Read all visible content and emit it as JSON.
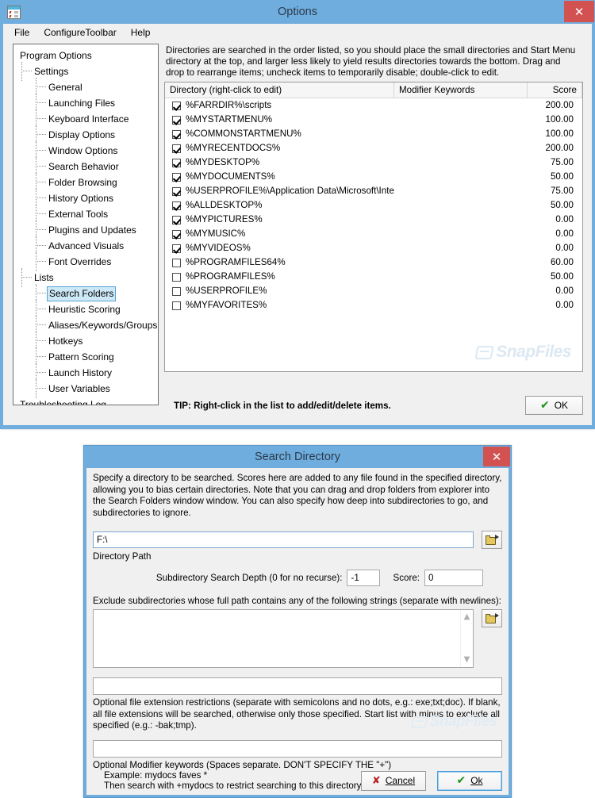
{
  "options_window": {
    "title": "Options",
    "icon": "options-checklist-icon",
    "close_label": "✕",
    "menu": [
      "File",
      "ConfigureToolbar",
      "Help"
    ],
    "tree": [
      {
        "label": "Program Options",
        "level": 0,
        "selected": false
      },
      {
        "label": "Settings",
        "level": 1,
        "selected": false
      },
      {
        "label": "General",
        "level": 2,
        "selected": false
      },
      {
        "label": "Launching Files",
        "level": 2,
        "selected": false
      },
      {
        "label": "Keyboard Interface",
        "level": 2,
        "selected": false
      },
      {
        "label": "Display Options",
        "level": 2,
        "selected": false
      },
      {
        "label": "Window Options",
        "level": 2,
        "selected": false
      },
      {
        "label": "Search Behavior",
        "level": 2,
        "selected": false
      },
      {
        "label": "Folder Browsing",
        "level": 2,
        "selected": false
      },
      {
        "label": "History Options",
        "level": 2,
        "selected": false
      },
      {
        "label": "External Tools",
        "level": 2,
        "selected": false
      },
      {
        "label": "Plugins and Updates",
        "level": 2,
        "selected": false
      },
      {
        "label": "Advanced Visuals",
        "level": 2,
        "selected": false
      },
      {
        "label": "Font Overrides",
        "level": 2,
        "selected": false
      },
      {
        "label": "Lists",
        "level": 1,
        "selected": false
      },
      {
        "label": "Search Folders",
        "level": 2,
        "selected": true
      },
      {
        "label": "Heuristic Scoring",
        "level": 2,
        "selected": false
      },
      {
        "label": "Aliases/Keywords/Groups",
        "level": 2,
        "selected": false
      },
      {
        "label": "Hotkeys",
        "level": 2,
        "selected": false
      },
      {
        "label": "Pattern Scoring",
        "level": 2,
        "selected": false
      },
      {
        "label": "Launch History",
        "level": 2,
        "selected": false
      },
      {
        "label": "User Variables",
        "level": 2,
        "selected": false
      },
      {
        "label": "Troubleshooting Log",
        "level": 0,
        "selected": false
      }
    ],
    "description": "Directories are searched in the order listed, so you should place the small directories and Start Menu directory at the top, and larger less likely to yield results directories towards the bottom.  Drag and drop to rearrange items; uncheck items to temporarily disable; double-click to edit.",
    "list": {
      "columns": [
        "Directory (right-click to edit)",
        "Modifier Keywords",
        "Score"
      ],
      "rows": [
        {
          "checked": true,
          "directory": "%FARRDIR%\\scripts",
          "modifier": "",
          "score": "200.00"
        },
        {
          "checked": true,
          "directory": "%MYSTARTMENU%",
          "modifier": "",
          "score": "100.00"
        },
        {
          "checked": true,
          "directory": "%COMMONSTARTMENU%",
          "modifier": "",
          "score": "100.00"
        },
        {
          "checked": true,
          "directory": "%MYRECENTDOCS%",
          "modifier": "",
          "score": "200.00"
        },
        {
          "checked": true,
          "directory": "%MYDESKTOP%",
          "modifier": "",
          "score": "75.00"
        },
        {
          "checked": true,
          "directory": "%MYDOCUMENTS%",
          "modifier": "",
          "score": "50.00"
        },
        {
          "checked": true,
          "directory": "%USERPROFILE%\\Application Data\\Microsoft\\Inte...",
          "modifier": "",
          "score": "75.00"
        },
        {
          "checked": true,
          "directory": "%ALLDESKTOP%",
          "modifier": "",
          "score": "50.00"
        },
        {
          "checked": true,
          "directory": "%MYPICTURES%",
          "modifier": "",
          "score": "0.00"
        },
        {
          "checked": true,
          "directory": "%MYMUSIC%",
          "modifier": "",
          "score": "0.00"
        },
        {
          "checked": true,
          "directory": "%MYVIDEOS%",
          "modifier": "",
          "score": "0.00"
        },
        {
          "checked": false,
          "directory": "%PROGRAMFILES64%",
          "modifier": "",
          "score": "60.00"
        },
        {
          "checked": false,
          "directory": "%PROGRAMFILES%",
          "modifier": "",
          "score": "50.00"
        },
        {
          "checked": false,
          "directory": "%USERPROFILE%",
          "modifier": "",
          "score": "0.00"
        },
        {
          "checked": false,
          "directory": "%MYFAVORITES%",
          "modifier": "",
          "score": "0.00"
        }
      ]
    },
    "watermark": "SnapFiles",
    "tip": "TIP: Right-click in the list to add/edit/delete items.",
    "ok_label": "OK"
  },
  "search_window": {
    "title": "Search Directory",
    "close_label": "✕",
    "description": "Specify a directory to be searched. Scores here are added to any file found in the specified directory, allowing you to bias certain directories.  Note that you can drag and drop folders from explorer into the Search Folders window window.  You can also specify how deep into subdirectories to go, and subdirectories to ignore.",
    "directory_path": {
      "value": "F:\\",
      "placeholder": "",
      "label": "Directory Path",
      "browse_icon": "folder-open-icon"
    },
    "depth": {
      "label": "Subdirectory Search Depth (0 for no recurse):",
      "value": "-1"
    },
    "score": {
      "label": "Score:",
      "value": "0"
    },
    "exclude": {
      "label": "Exclude subdirectories whose full path contains any of the following strings (separate with newlines):",
      "value": "",
      "placeholder": "",
      "browse_icon": "folder-open-icon",
      "scroll_up": "︿",
      "scroll_down": "﹀"
    },
    "extensions": {
      "value": "",
      "placeholder": "",
      "help": "Optional file extension restrictions (separate with semicolons and no dots, e.g.: exe;txt;doc).  If blank, all file extensions will be searched, otherwise only those specified.  Start list with minus to exclude all specified (e.g.: -bak;tmp)."
    },
    "modifier_keywords": {
      "value": "",
      "placeholder": "",
      "help_line1": "Optional Modifier keywords (Spaces separate. DON'T SPECIFY THE \"+\")",
      "help_line2": "Example: mydocs faves *",
      "help_line3": "Then search with +mydocs to restrict searching to this directory."
    },
    "watermark": "SnapFiles",
    "cancel_label": "Cancel",
    "ok_label": "Ok"
  },
  "colors": {
    "titlebar": "#6fadde",
    "close": "#d25252",
    "selection": "#cde8f6",
    "dialog_bg": "#f0f0f0",
    "watermark": "#dce8f3"
  }
}
